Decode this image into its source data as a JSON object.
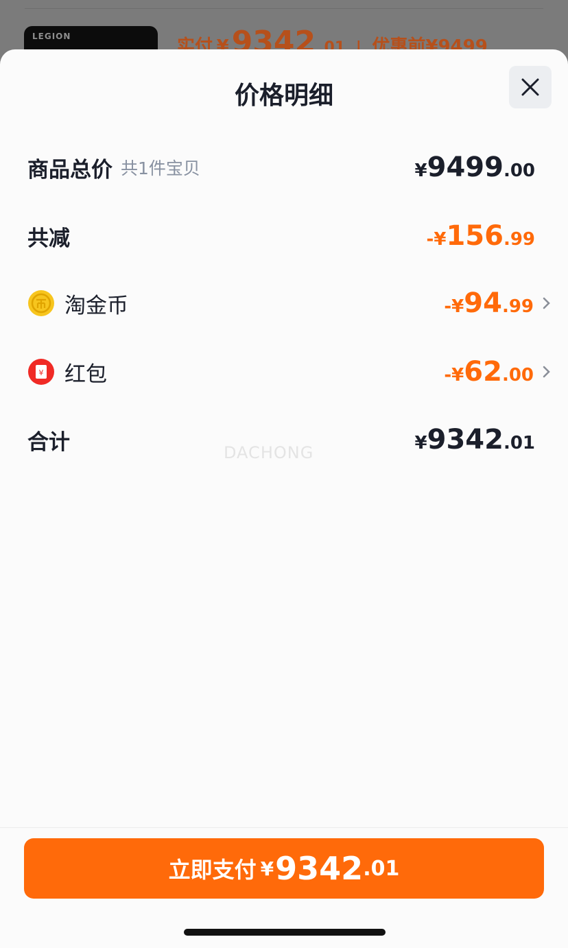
{
  "background": {
    "product_logo": "LEGION",
    "actual_pay_label": "实付",
    "currency": "¥",
    "actual_pay_int": "9342",
    "actual_pay_dec": ".01",
    "separator": "|",
    "before_discount_label": "优惠前",
    "before_discount_value": "¥9499"
  },
  "sheet": {
    "title": "价格明细",
    "close_icon": "close-icon"
  },
  "rows": {
    "goods_total": {
      "label": "商品总价",
      "sub": "共1件宝贝",
      "currency": "¥",
      "int": "9499",
      "dec": ".00"
    },
    "total_discount": {
      "label": "共减",
      "currency": "-¥",
      "int": "156",
      "dec": ".99"
    },
    "coins": {
      "label": "淘金币",
      "icon": "gold-coin-icon",
      "currency": "-¥",
      "int": "94",
      "dec": ".99"
    },
    "red_packet": {
      "label": "红包",
      "icon": "red-packet-icon",
      "icon_text": "¥",
      "currency": "-¥",
      "int": "62",
      "dec": ".00"
    },
    "grand_total": {
      "label": "合计",
      "currency": "¥",
      "int": "9342",
      "dec": ".01"
    }
  },
  "watermark": "DACHONG",
  "pay_button": {
    "label": "立即支付",
    "currency": "¥",
    "int": "9342",
    "dec": ".01"
  },
  "colors": {
    "accent": "#ff6a0a",
    "text": "#1b1f2b",
    "muted": "#8891a1"
  }
}
